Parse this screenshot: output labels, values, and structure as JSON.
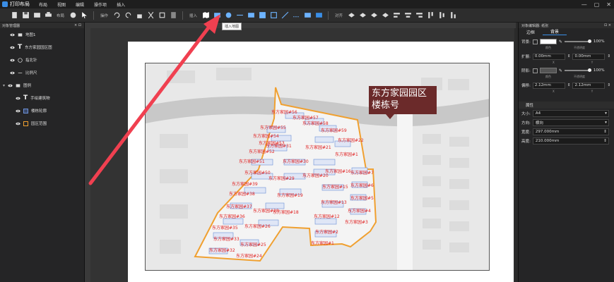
{
  "app": {
    "title": "打印布局"
  },
  "menu": [
    "布局",
    "视图",
    "编辑",
    "操作项",
    "插入"
  ],
  "window_controls": [
    "—",
    "▢",
    "✕"
  ],
  "toolbar": {
    "group_layout": "布局",
    "group_ops": "操作",
    "group_insert": "插入",
    "group_align": "对齐",
    "tooltip": "插入地图"
  },
  "left_panel": {
    "title": "对象管理器",
    "close": "× ⊡",
    "layers": [
      {
        "label": "地图1",
        "type": "folder"
      },
      {
        "label": "东方家园园区图",
        "type": "text"
      },
      {
        "label": "指北针",
        "type": "compass"
      },
      {
        "label": "比例尺",
        "type": "scale"
      },
      {
        "label": "图例",
        "type": "folder"
      },
      {
        "label": "手绘建筑物",
        "type": "text"
      },
      {
        "label": "楼栋轮廓",
        "type": "legend"
      },
      {
        "label": "园区范围",
        "type": "legend"
      }
    ]
  },
  "map_title": {
    "line1": "东方家园园区",
    "line2": "楼栋号"
  },
  "buildings": [
    {
      "label": "东方家园#56"
    },
    {
      "label": "东方家园#57"
    },
    {
      "label": "东方家园#58"
    },
    {
      "label": "东方家园#55"
    },
    {
      "label": "东方家园#59"
    },
    {
      "label": "东方家园#54"
    },
    {
      "label": "东方家园#53"
    },
    {
      "label": "东方家园#22"
    },
    {
      "label": "东方家园#21"
    },
    {
      "label": "东方家园#31"
    },
    {
      "label": "东方家园#52"
    },
    {
      "label": "东方家园#51"
    },
    {
      "label": "东方家园#30"
    },
    {
      "label": "东方家园#1"
    },
    {
      "label": "东方家园#50"
    },
    {
      "label": "东方家园#29"
    },
    {
      "label": "东方家园#20"
    },
    {
      "label": "东方家园#16"
    },
    {
      "label": "东方家园#7"
    },
    {
      "label": "东方家园#39"
    },
    {
      "label": "东方家园#6"
    },
    {
      "label": "东方家园#15"
    },
    {
      "label": "东方家园#38"
    },
    {
      "label": "东方家园#19"
    },
    {
      "label": "东方家园#5"
    },
    {
      "label": "东方家园#37"
    },
    {
      "label": "东方家园#13"
    },
    {
      "label": "东方家园#28"
    },
    {
      "label": "东方家园#18"
    },
    {
      "label": "东方家园#4"
    },
    {
      "label": "东方家园#36"
    },
    {
      "label": "东方家园#12"
    },
    {
      "label": "东方家园#3"
    },
    {
      "label": "东方家园#35"
    },
    {
      "label": "东方家园#26"
    },
    {
      "label": "东方家园#2"
    },
    {
      "label": "东方家园#33"
    },
    {
      "label": "东方家园#1"
    },
    {
      "label": "东方家园#25"
    },
    {
      "label": "东方家园#32"
    },
    {
      "label": "东方家园#24"
    }
  ],
  "right_panel": {
    "title": "对象编辑器: 纸张",
    "tabs": [
      "边框",
      "背景"
    ],
    "bg_label": "背景:",
    "bg_opacity": "100%",
    "expand_label": "扩展:",
    "expand_x": "0.00mm",
    "expand_y": "0.00mm",
    "shadow_label": "阴影:",
    "shadow_opacity": "100%",
    "offset_label": "偏移:",
    "offset_x": "2.12mm",
    "offset_y": "2.12mm",
    "note_color": "颜色",
    "note_opacity": "不透明度",
    "axis_x": "X",
    "axis_y": "Y",
    "attr_title": "属性",
    "size_label": "大小:",
    "size_value": "A4",
    "orient_label": "方向:",
    "orient_value": "横向",
    "width_label": "宽度:",
    "width_value": "297.000mm",
    "height_label": "高度:",
    "height_value": "210.000mm"
  }
}
